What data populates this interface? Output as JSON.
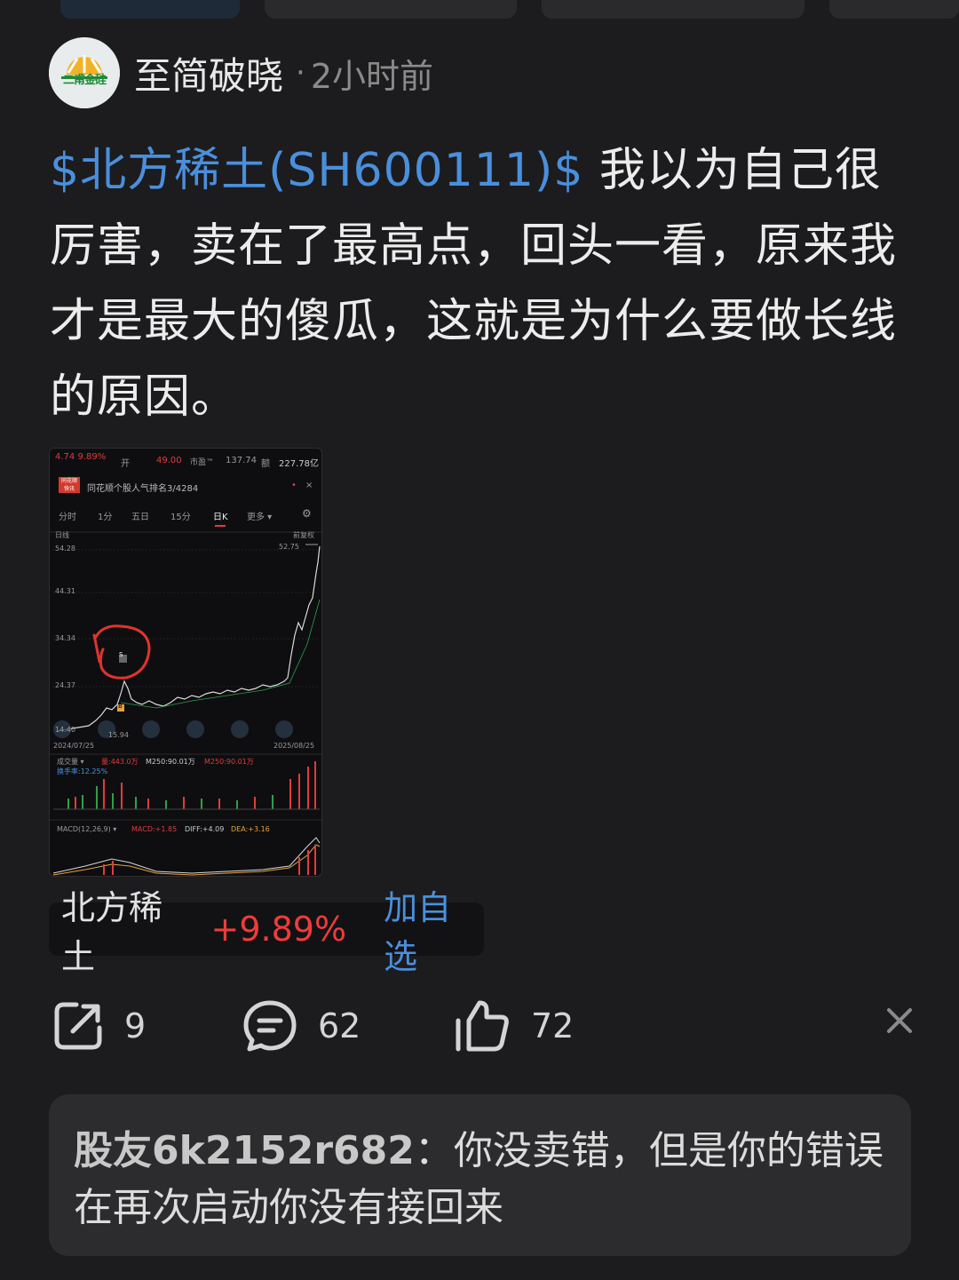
{
  "post": {
    "author": "至简破晓",
    "separator": "·",
    "time": "2小时前",
    "avatar_text": "二甫金硅",
    "stock_link": "$北方稀土(SH600111)$",
    "text_body": " 我以为自己很厉害，卖在了最高点，回头一看，原来我才是最大的傻瓜，这就是为什么要做长线的原因。"
  },
  "chart_thumbnail": {
    "price_change": "4.74  9.89%",
    "open_label": "开",
    "open_value": "49.00",
    "pe_label": "市盈™",
    "pe_value": "137.74",
    "amount_label": "额",
    "amount_value": "227.78亿",
    "banner_badge": "同花顺 快讯",
    "banner_text": "同花顺个股人气排名3/4284",
    "tabs": [
      "分时",
      "1分",
      "五日",
      "15分",
      "日K",
      "更多 ▾"
    ],
    "chart_label": "日线",
    "adjust_label": "前复权",
    "y_ticks": [
      "54.28",
      "44.31",
      "34.34",
      "24.37",
      "14.40"
    ],
    "high_label": "52.75",
    "low_label": "15.94",
    "date_start": "2024/07/25",
    "date_end": "2025/08/25",
    "volume_label": "成交量 ▾",
    "volume_value": "量:443.0万",
    "m250_a": "M250:90.01万",
    "m250_b": "M250:90.01万",
    "turnover": "换手率:12.25%",
    "macd_label": "MACD(12,26,9) ▾",
    "macd_value": "MACD:+1.85",
    "diff_value": "DIFF:+4.09",
    "dea_value": "DEA:+3.16",
    "buy_marker": "B",
    "sell_marker": "S"
  },
  "stock_chip": {
    "name": "北方稀土",
    "change": "+9.89%",
    "follow_label": "加自选"
  },
  "actions": {
    "share_count": "9",
    "comment_count": "62",
    "like_count": "72"
  },
  "comment": {
    "author": "股友6k2152r682",
    "separator": "：",
    "text": "你没卖错，但是你的错误在再次启动你没有接回来"
  },
  "colors": {
    "background": "#1c1c1e",
    "link_blue": "#4a8fdc",
    "up_red": "#f03b3b",
    "down_green": "#2ea04a"
  }
}
